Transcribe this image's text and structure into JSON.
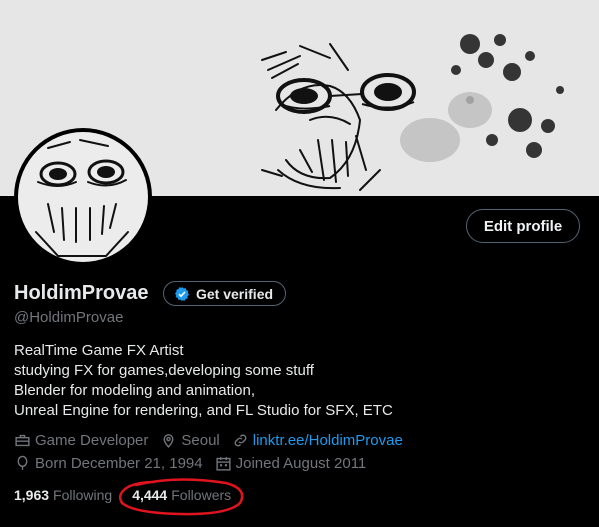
{
  "profile": {
    "display_name": "HoldimProvae",
    "handle": "@HoldimProvae",
    "edit_label": "Edit profile",
    "verify_label": "Get verified",
    "bio_lines": [
      "RealTime Game FX Artist",
      "studying FX for games,developing some stuff",
      "Blender for modeling and animation,",
      "Unreal Engine for rendering, and FL Studio for SFX, ETC"
    ],
    "meta": {
      "category": "Game Developer",
      "location": "Seoul",
      "link": "linktr.ee/HoldimProvae",
      "born": "Born December 21, 1994",
      "joined": "Joined August 2011"
    },
    "stats": {
      "following_count": "1,963",
      "following_label": "Following",
      "followers_count": "4,444",
      "followers_label": "Followers"
    }
  },
  "icons": [
    "briefcase-icon",
    "location-pin-icon",
    "link-icon",
    "balloon-icon",
    "calendar-icon",
    "verified-badge-icon"
  ],
  "colors": {
    "accent": "#1d9bf0",
    "annotation": "#e0141e",
    "background": "#000000",
    "banner": "#e6e6e6"
  }
}
